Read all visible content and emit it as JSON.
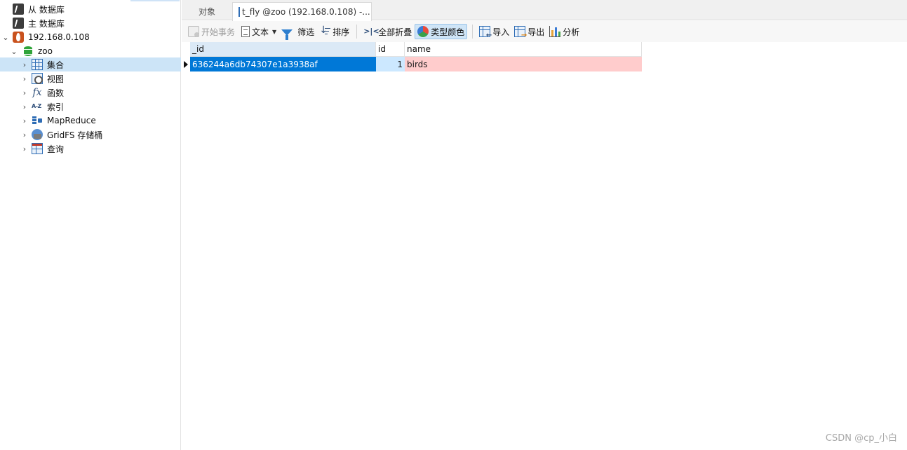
{
  "sidebar": {
    "items": [
      {
        "label": "从 数据库"
      },
      {
        "label": "主 数据库"
      },
      {
        "label": "192.168.0.108"
      },
      {
        "label": "zoo"
      },
      {
        "label": "集合"
      },
      {
        "label": "视图"
      },
      {
        "label": "函数"
      },
      {
        "label": "索引"
      },
      {
        "label": "MapReduce"
      },
      {
        "label": "GridFS 存储桶"
      },
      {
        "label": "查询"
      }
    ]
  },
  "tabs": {
    "objects": "对象",
    "active": "t_fly @zoo (192.168.0.108) -..."
  },
  "toolbar": {
    "begin": "开始事务",
    "text": "文本",
    "filter": "筛选",
    "sort": "排序",
    "collapse_all": "全部折叠",
    "type_color": "类型颜色",
    "import": "导入",
    "export": "导出",
    "analyze": "分析"
  },
  "grid": {
    "columns": [
      "_id",
      "id",
      "name"
    ],
    "rows": [
      {
        "_id": "636244a6db74307e1a3938af",
        "id": "1",
        "name": "birds"
      }
    ]
  },
  "watermark": "CSDN @cp_小白",
  "colors": {
    "selection": "#0078d7",
    "type_int": "#cce8ff",
    "type_string": "#ffcccc"
  }
}
